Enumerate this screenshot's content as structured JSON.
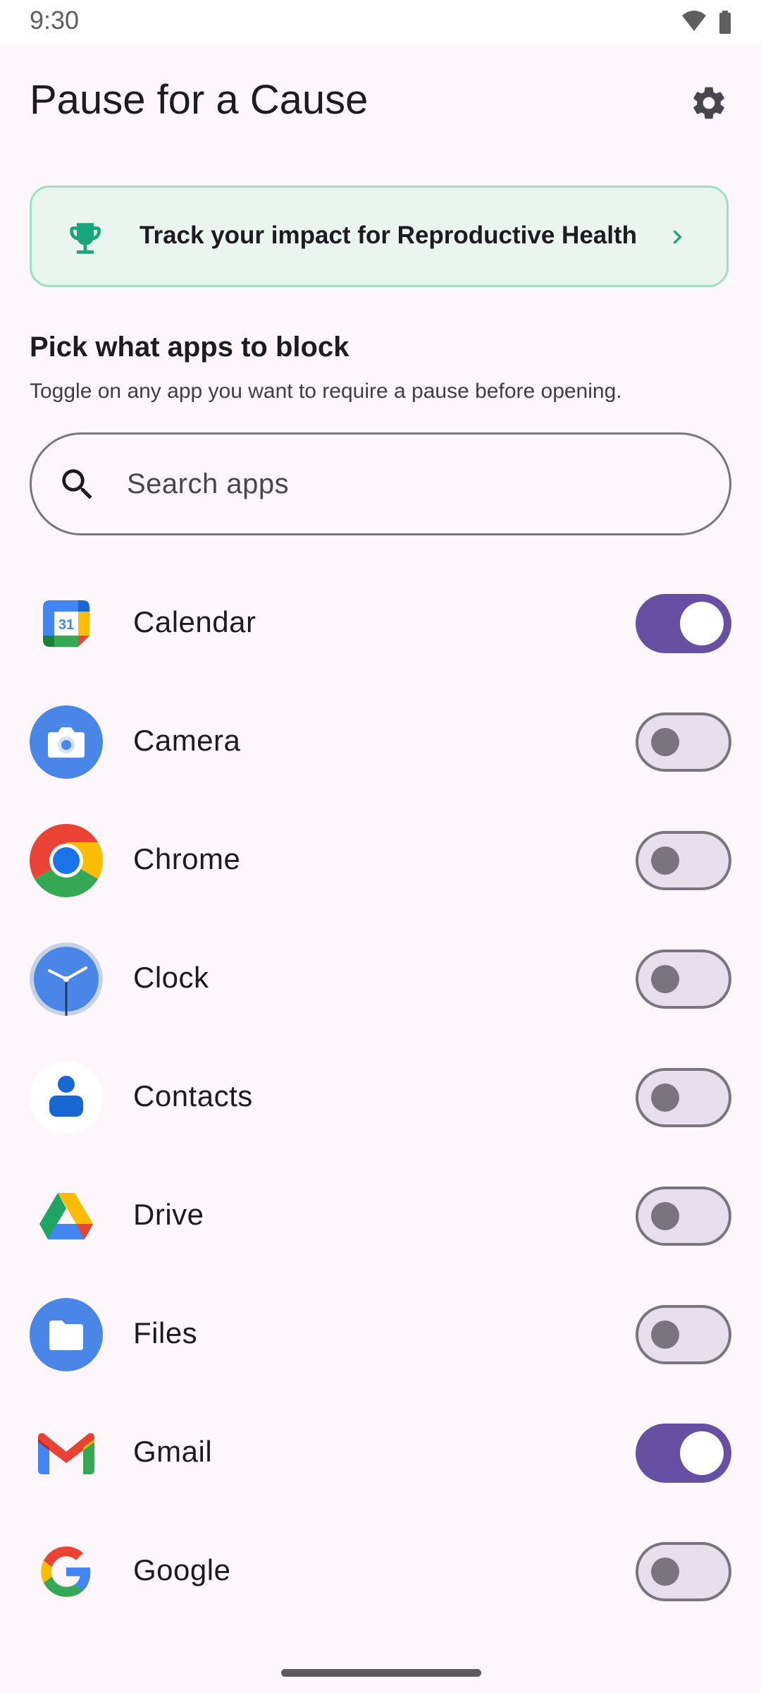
{
  "status_bar": {
    "time": "9:30",
    "icons": [
      "wifi-icon",
      "battery-icon"
    ]
  },
  "app_bar": {
    "title": "Pause for a Cause",
    "settings_icon": "gear-icon"
  },
  "impact_card": {
    "label": "Track your impact for Reproductive Health",
    "icon": "trophy-icon",
    "accent": "#1aa57a"
  },
  "section": {
    "title": "Pick what apps to block",
    "subtitle": "Toggle on any app you want to require a pause before opening."
  },
  "search": {
    "placeholder": "Search apps"
  },
  "apps": [
    {
      "name": "Calendar",
      "icon": "calendar-icon",
      "enabled": true
    },
    {
      "name": "Camera",
      "icon": "camera-icon",
      "enabled": false
    },
    {
      "name": "Chrome",
      "icon": "chrome-icon",
      "enabled": false
    },
    {
      "name": "Clock",
      "icon": "clock-icon",
      "enabled": false
    },
    {
      "name": "Contacts",
      "icon": "contacts-icon",
      "enabled": false
    },
    {
      "name": "Drive",
      "icon": "drive-icon",
      "enabled": false
    },
    {
      "name": "Files",
      "icon": "files-icon",
      "enabled": false
    },
    {
      "name": "Gmail",
      "icon": "gmail-icon",
      "enabled": true
    },
    {
      "name": "Google",
      "icon": "google-icon",
      "enabled": false
    }
  ],
  "colors": {
    "toggle_on": "#6750a4",
    "toggle_off_track": "#e7e0ec",
    "card_bg": "#eaf5f0",
    "card_border": "#9ee0c3"
  }
}
